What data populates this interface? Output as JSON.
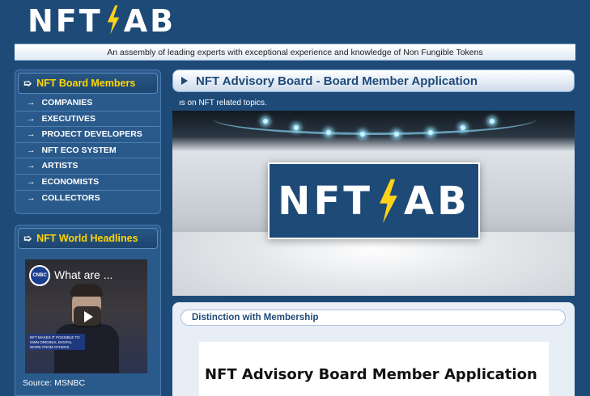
{
  "header": {
    "logo_text_left": "NFT",
    "logo_text_right": "AB",
    "tagline": "An assembly of leading experts with exceptional experience and knowledge of Non Fungible Tokens"
  },
  "sidebar": {
    "board_members": {
      "heading": "NFT Board Members",
      "items": [
        {
          "label": "COMPANIES"
        },
        {
          "label": "EXECUTIVES"
        },
        {
          "label": "PROJECT DEVELOPERS"
        },
        {
          "label": "NFT ECO SYSTEM"
        },
        {
          "label": "ARTISTS"
        },
        {
          "label": "ECONOMISTS"
        },
        {
          "label": "COLLECTORS"
        }
      ]
    },
    "headlines": {
      "heading": "NFT World Headlines",
      "video": {
        "channel_badge": "CNBC",
        "title": "What are ...",
        "caption": "NFT MAKES IT POSSIBLE TO OWN ORIGINAL DIGITAL WORK FROM OTHERS"
      },
      "source": "Source: MSNBC"
    }
  },
  "main": {
    "page_title": "NFT Advisory Board - Board Member Application",
    "subline": "ıs on NFT related topics.",
    "banner": {
      "logo_text_left": "NFT",
      "logo_text_right": "AB"
    },
    "distinction_tab": "Distinction with Membership",
    "document_heading": "NFT Advisory Board Member Application"
  },
  "colors": {
    "brand_blue": "#1e4a78",
    "accent_yellow": "#ffd700",
    "text_white": "#ffffff"
  },
  "icons": {
    "menu_arrow": "arrow-right-icon",
    "heading_arrow": "hand-pointer-icon",
    "title_marker": "triangle-right-icon",
    "logo_mark": "lightning-bolt-icon",
    "video_play": "play-icon"
  }
}
